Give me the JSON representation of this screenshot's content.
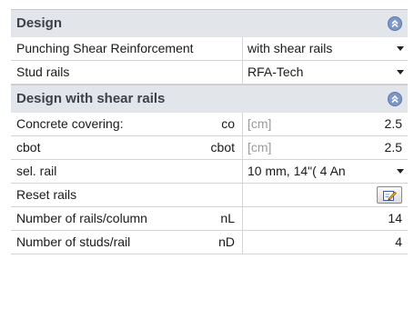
{
  "sections": {
    "design": {
      "title": "Design"
    },
    "design_with_shear_rails": {
      "title": "Design with shear rails"
    }
  },
  "rows": {
    "punching_shear": {
      "label": "Punching Shear Reinforcement",
      "value": "with shear rails"
    },
    "stud_rails": {
      "label": "Stud rails",
      "value": "RFA-Tech"
    },
    "concrete_covering": {
      "label": "Concrete covering:",
      "symbol": "co",
      "unit": "[cm]",
      "value": "2.5"
    },
    "cbot": {
      "label": "cbot",
      "symbol": "cbot",
      "unit": "[cm]",
      "value": "2.5"
    },
    "sel_rail": {
      "label": "sel. rail",
      "value": "10 mm,  14\"( 4 An"
    },
    "reset_rails": {
      "label": "Reset rails"
    },
    "num_rails": {
      "label": "Number of rails/column",
      "symbol": "nL",
      "value": "14"
    },
    "num_studs": {
      "label": "Number of studs/rail",
      "symbol": "nD",
      "value": "4"
    }
  },
  "icons": {
    "collapse": "chevron-up-double-icon",
    "edit": "edit-icon"
  },
  "colors": {
    "section_bg": "#e2e5ea",
    "accent": "#7c97c7"
  }
}
